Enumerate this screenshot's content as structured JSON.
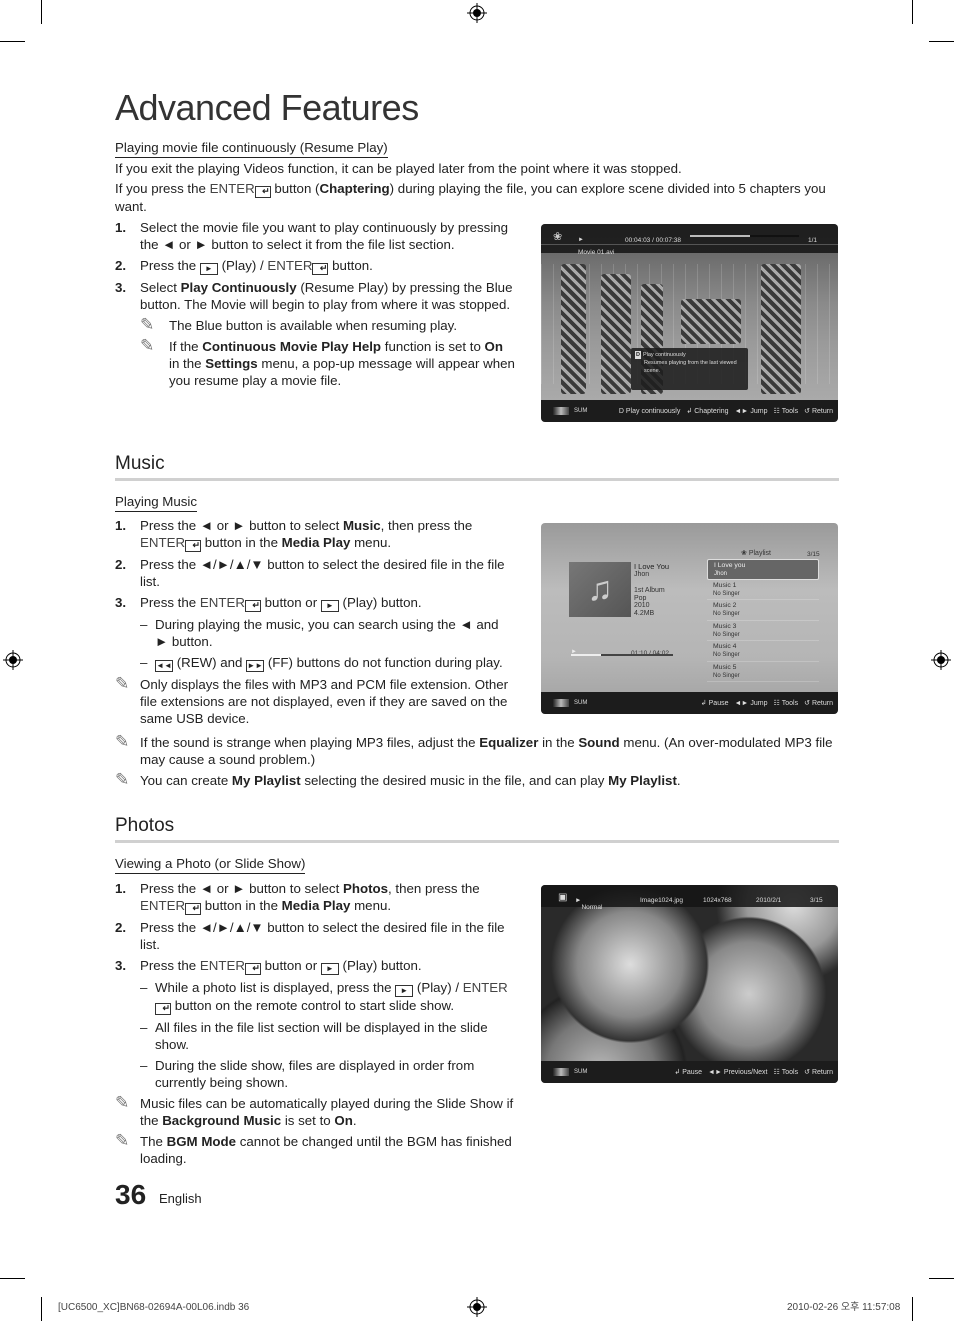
{
  "page": {
    "title": "Advanced Features",
    "page_number": "36",
    "language": "English"
  },
  "resume": {
    "heading": "Playing movie file continuously (Resume Play)",
    "intro1": "If you exit the playing Videos function, it can be played later from the point where it was stopped.",
    "intro2_a": "If you press the ",
    "intro2_enter": "ENTER",
    "intro2_b": " button (",
    "intro2_bold": "Chaptering",
    "intro2_c": ") during playing the file, you can explore scene divided into 5 chapters you want.",
    "steps": [
      {
        "num": "1.",
        "text": "Select the movie file you want to play continuously by pressing the ◄ or ► button to select it from the file list section."
      },
      {
        "num": "2.",
        "a": "Press the ",
        "b": " (Play) / ",
        "enter": "ENTER",
        "c": " button."
      },
      {
        "num": "3.",
        "a": "Select ",
        "bold": "Play Continuously",
        "b": " (Resume Play) by pressing the Blue button. The Movie will begin to play from where it was stopped."
      }
    ],
    "note1": "The Blue button is available when resuming play.",
    "note2": {
      "a": "If the ",
      "b1": "Continuous Movie Play Help",
      "c": " function is set to ",
      "b2": "On",
      "d": " in the ",
      "b3": "Settings",
      "e": " menu, a pop-up message will appear when you resume play a movie file."
    }
  },
  "movie_screen": {
    "time": "00:04:03 / 00:07:38",
    "progress": 0.55,
    "count": "1/1",
    "filename": "Movie 01.avi",
    "popup_title": "Play continuously",
    "popup_key": "D",
    "popup_text": "Resumes playing from the last viewed scene.",
    "device": "SUM",
    "actions": [
      {
        "icon": "D",
        "label": "Play continuously"
      },
      {
        "icon": "↲",
        "label": "Chaptering"
      },
      {
        "icon": "◄►",
        "label": "Jump"
      },
      {
        "icon": "☷",
        "label": "Tools"
      },
      {
        "icon": "↺",
        "label": "Return"
      }
    ]
  },
  "music": {
    "section_title": "Music",
    "heading": "Playing Music",
    "step1": {
      "a": "Press the ◄ or ► button to select ",
      "b1": "Music",
      "c": ", then press the ",
      "enter": "ENTER",
      "d": " button in the ",
      "b2": "Media Play",
      "e": " menu."
    },
    "step2": "Press the ◄/►/▲/▼ button to select the desired file in the file list.",
    "step3": {
      "a": "Press the ",
      "enter": "ENTER",
      "b": " button or ",
      "c": " (Play) button."
    },
    "dash1": "During playing the music, you can search using the ◄ and ► button.",
    "dash2": {
      "rew": "◄◄",
      "a": " (REW) and ",
      "ff": "►►",
      "b": " (FF) buttons do not function during play."
    },
    "note1": "Only displays the files with MP3 and PCM file extension. Other file extensions are not displayed, even if they are saved on the same USB device.",
    "note2": {
      "a": "If the sound is strange when playing MP3 files, adjust the ",
      "b1": "Equalizer",
      "c": " in the ",
      "b2": "Sound",
      "d": " menu. (An over-modulated MP3 file may cause a sound problem.)"
    },
    "note3": {
      "a": "You can create ",
      "b1": "My Playlist",
      "c": " selecting the desired music in the file, and can play ",
      "b2": "My Playlist",
      "d": "."
    }
  },
  "music_screen": {
    "playlist_label": "Playlist",
    "count": "3/15",
    "now_title": "I Love You",
    "now_artist": "Jhon",
    "album": "1st Album",
    "genre": "Pop",
    "year": "2010",
    "size": "4.2MB",
    "time": "01:10 / 04:02",
    "progress": 0.29,
    "playlist": [
      {
        "title": "I Love you",
        "artist": "Jhon"
      },
      {
        "title": "Music 1",
        "artist": "No Singer"
      },
      {
        "title": "Music 2",
        "artist": "No Singer"
      },
      {
        "title": "Music 3",
        "artist": "No Singer"
      },
      {
        "title": "Music 4",
        "artist": "No Singer"
      },
      {
        "title": "Music 5",
        "artist": "No Singer"
      }
    ],
    "device": "SUM",
    "actions": [
      {
        "icon": "↲",
        "label": "Pause"
      },
      {
        "icon": "◄►",
        "label": "Jump"
      },
      {
        "icon": "☷",
        "label": "Tools"
      },
      {
        "icon": "↺",
        "label": "Return"
      }
    ]
  },
  "photos": {
    "section_title": "Photos",
    "heading": "Viewing a Photo (or Slide Show)",
    "step1": {
      "a": "Press the ◄ or ► button to select ",
      "b1": "Photos",
      "c": ", then press the ",
      "enter": "ENTER",
      "d": " button in the ",
      "b2": "Media Play",
      "e": " menu."
    },
    "step2": "Press the ◄/►/▲/▼ button to select the desired file in the file list.",
    "step3": {
      "a": "Press the ",
      "enter": "ENTER",
      "b": " button or ",
      "c": " (Play) button."
    },
    "dash1": {
      "a": "While a photo list is displayed, press the ",
      "b": " (Play) / ",
      "enter": "ENTER",
      "c": " button on the remote control to start slide show."
    },
    "dash2": "All files in the file list section will be displayed in the slide show.",
    "dash3": "During the slide show, files are displayed in order from currently being shown.",
    "note1": {
      "a": "Music files can be automatically played during the Slide Show if the ",
      "b1": "Background Music",
      "c": " is set to ",
      "b2": "On",
      "d": "."
    },
    "note2": {
      "a": "The ",
      "b1": "BGM Mode",
      "c": " cannot be changed until the BGM has finished loading."
    }
  },
  "photo_screen": {
    "mode": "Normal",
    "filename": "Image1024.jpg",
    "resolution": "1024x768",
    "date": "2010/2/1",
    "count": "3/15",
    "device": "SUM",
    "actions": [
      {
        "icon": "↲",
        "label": "Pause"
      },
      {
        "icon": "◄►",
        "label": "Previous/Next"
      },
      {
        "icon": "☷",
        "label": "Tools"
      },
      {
        "icon": "↺",
        "label": "Return"
      }
    ]
  },
  "slug": {
    "left": "[UC6500_XC]BN68-02694A-00L06.indb   36",
    "right": "2010-02-26   오후 11:57:08"
  },
  "icons": {
    "pencil": "✎",
    "play": "►",
    "enter": "↵"
  }
}
